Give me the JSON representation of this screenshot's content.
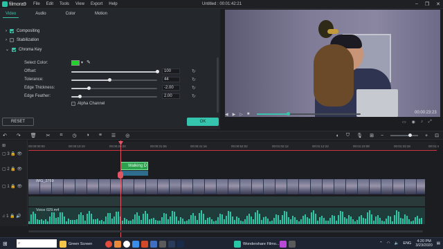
{
  "app": {
    "logo": "filmora9",
    "menu": [
      "File",
      "Edit",
      "Tools",
      "View",
      "Export",
      "Help"
    ],
    "window_title": "Untitled : 00:01:42:21",
    "window_controls": [
      "–",
      "❐",
      "✕"
    ]
  },
  "panel": {
    "tabs": [
      "Video",
      "Audio",
      "Color",
      "Motion"
    ],
    "active_tab": "Video",
    "sections": [
      {
        "label": "Compositing",
        "checked": true
      },
      {
        "label": "Stabilization",
        "checked": false
      },
      {
        "label": "Chroma Key",
        "checked": true
      }
    ],
    "select_color_label": "Select Color:",
    "select_color": "#21d12a",
    "sliders": [
      {
        "label": "Offset:",
        "value": "100",
        "fraction": 1.0
      },
      {
        "label": "Tolerance:",
        "value": "44",
        "fraction": 0.44
      },
      {
        "label": "Edge Thickness:",
        "value": "-2.00",
        "fraction": 0.2
      },
      {
        "label": "Edge Feather:",
        "value": "2.00",
        "fraction": 0.1
      }
    ],
    "alpha_channel_label": "Alpha Channel",
    "reset_label": "RESET",
    "ok_label": "OK"
  },
  "player": {
    "timecode": "00:00:23:23",
    "progress": 0.3,
    "controls": [
      "◀",
      "▶",
      "▷",
      "■"
    ]
  },
  "timeline": {
    "ruler_ticks": [
      "00:00:00:00",
      "00:00:10:10",
      "00:00:20:20",
      "00:00:31:06",
      "00:00:41:16",
      "00:00:52:02",
      "00:01:02:12",
      "00:01:12:22",
      "00:01:23:08",
      "00:01:33:18",
      "00:01:4"
    ],
    "clips": {
      "overlay": "Walking D",
      "video": "IMG_2759",
      "audio": "Voice 029.m4"
    },
    "track_labels": [
      "3",
      "2",
      "1",
      "1"
    ]
  },
  "taskbar": {
    "search_placeholder": "",
    "items": [
      "Green Screen",
      "Wondershare Filmo..."
    ],
    "tray": {
      "lang": "ENG",
      "time": "4:20 PM",
      "date": "3/23/2020"
    }
  },
  "colors": {
    "accent": "#3cc3ac",
    "playhead": "#e25563"
  }
}
